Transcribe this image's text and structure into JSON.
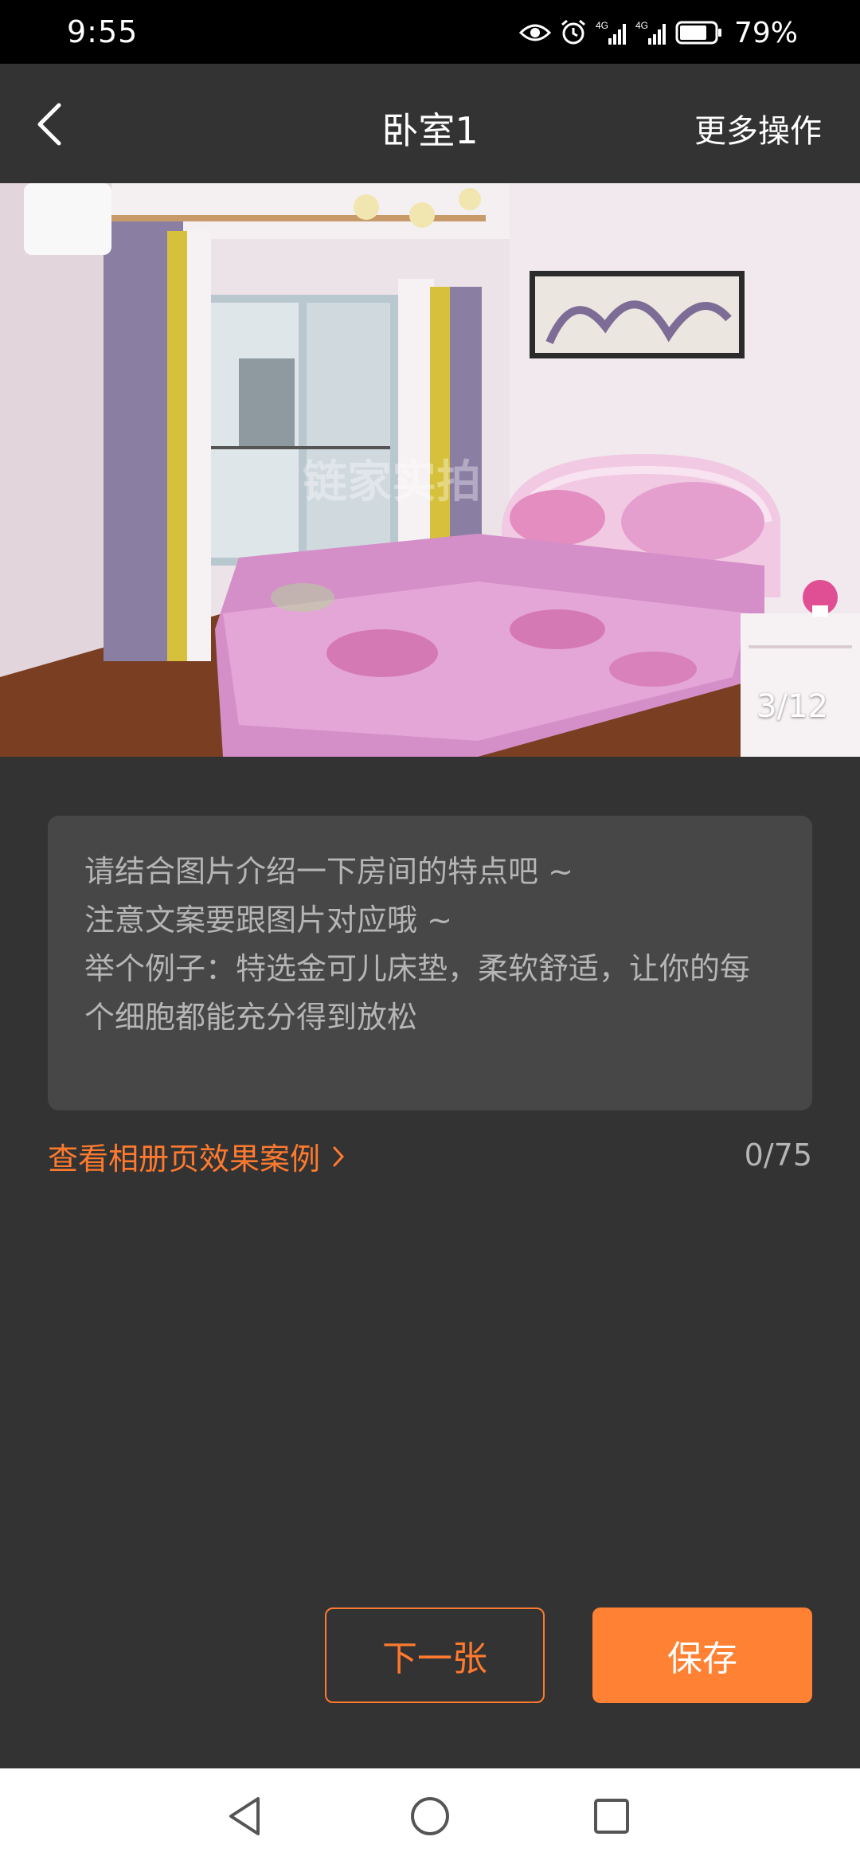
{
  "status_bar": {
    "time": "9:55",
    "battery_percent": "79%",
    "battery_level": 0.79,
    "network_1": "4G",
    "network_2": "4G",
    "icons": [
      "eye-icon",
      "alarm-icon",
      "signal-4g-icon",
      "signal-4g-icon",
      "battery-icon"
    ]
  },
  "header": {
    "title": "卧室1",
    "more_actions": "更多操作",
    "back_icon": "chevron-left-icon"
  },
  "photo": {
    "counter": "3/12",
    "watermark": "链家实拍"
  },
  "description": {
    "placeholder": "请结合图片介绍一下房间的特点吧 ~\n注意文案要跟图片对应哦 ~\n举个例子：特选金可儿床垫，柔软舒适，让你的每个细胞都能充分得到放松",
    "value": ""
  },
  "footer_row": {
    "example_link": "查看相册页效果案例",
    "char_count": "0/75"
  },
  "actions": {
    "next_label": "下一张",
    "save_label": "保存"
  },
  "colors": {
    "accent": "#ff7a2e",
    "background": "#333333",
    "input_bg": "#474747"
  }
}
